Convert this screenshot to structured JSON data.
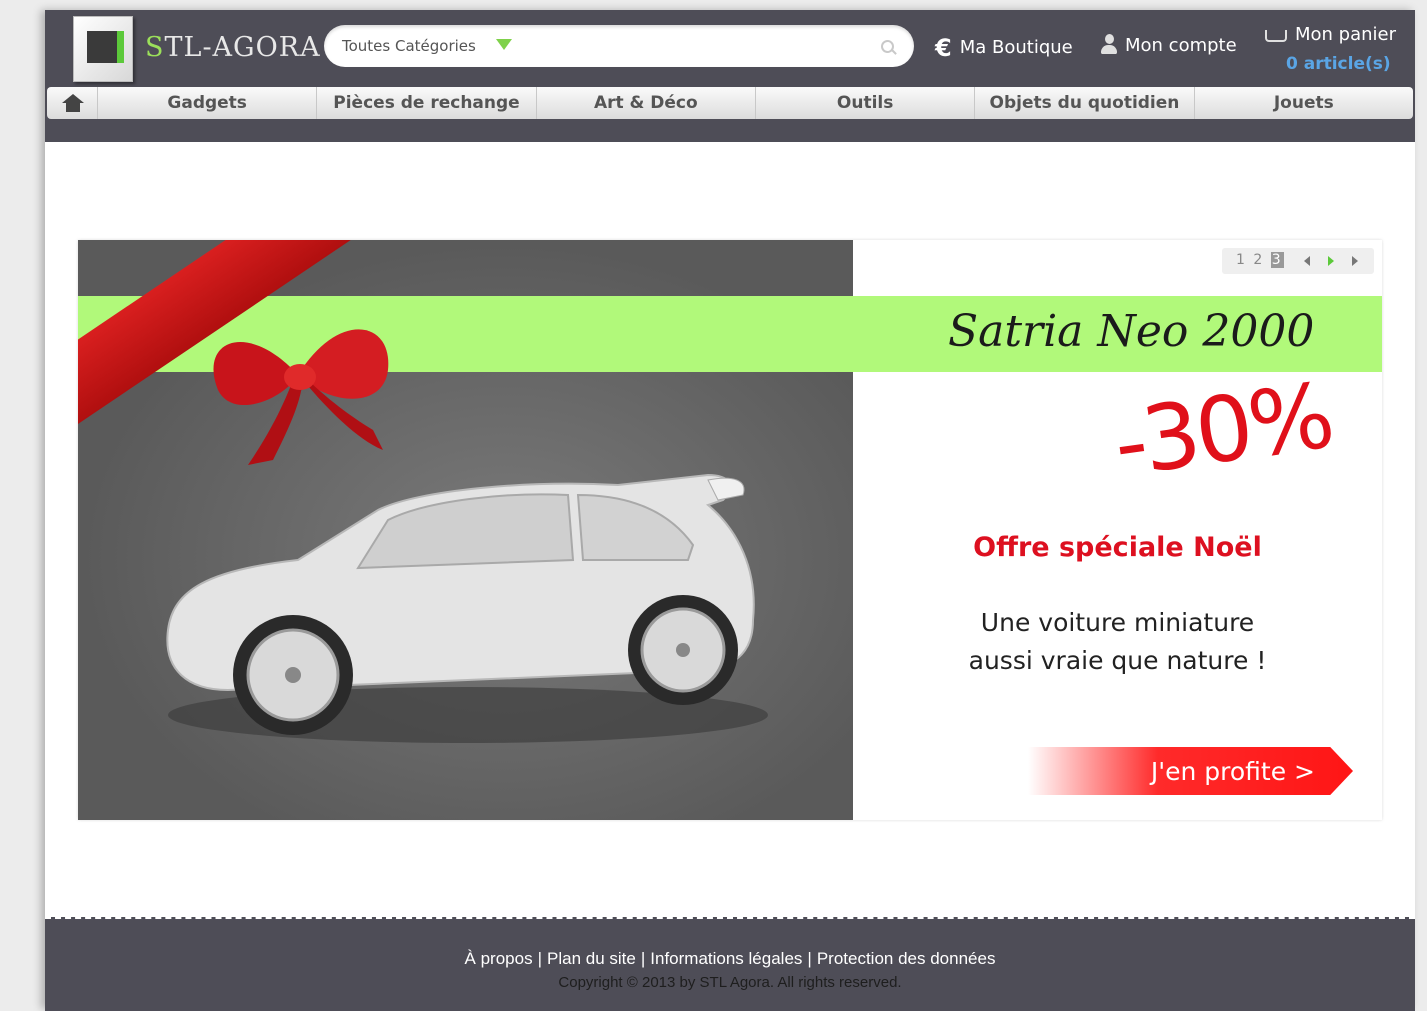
{
  "brand": {
    "name_initial": "S",
    "name_rest": "TL-AGORA"
  },
  "search": {
    "category": "Toutes Catégories",
    "placeholder": ""
  },
  "header_links": {
    "shop_symbol": "€",
    "shop": "Ma Boutique",
    "account": "Mon compte",
    "cart_label": "Mon panier",
    "cart_count": "0 article(s)"
  },
  "nav": {
    "items": [
      {
        "label": "Gadgets"
      },
      {
        "label": "Pièces de rechange"
      },
      {
        "label": "Art & Déco"
      },
      {
        "label": "Outils"
      },
      {
        "label": "Objets du quotidien"
      },
      {
        "label": "Jouets"
      }
    ]
  },
  "slider": {
    "pages": [
      "1",
      "2",
      "3"
    ],
    "active_page": "3",
    "product_name": "Satria Neo 2000",
    "discount": "-30%",
    "offer": "Offre spéciale Noël",
    "tagline_line1": "Une voiture miniature",
    "tagline_line2": "aussi vraie que nature !",
    "cta": "J'en profite >"
  },
  "footer": {
    "links": [
      {
        "label": "À propos"
      },
      {
        "label": "Plan du site"
      },
      {
        "label": "Informations légales"
      },
      {
        "label": "Protection des données"
      }
    ],
    "separator": "|",
    "copyright": "Copyright © 2013 by STL Agora. All rights reserved."
  },
  "colors": {
    "header_bg": "#4e4d57",
    "accent_green": "#b1f97a",
    "accent_red": "#e0101a",
    "cart_count": "#5aa5e5"
  }
}
